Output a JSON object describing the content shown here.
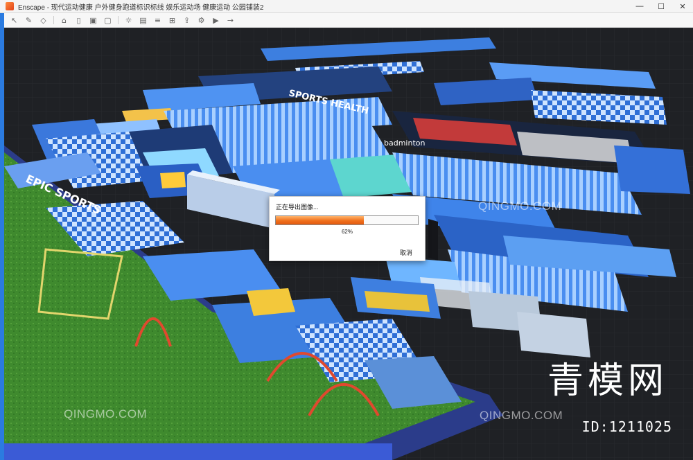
{
  "window": {
    "title": "Enscape - 现代运动健康 户外健身跑道标识标线 娱乐运动场 健康运动 公园铺装2",
    "controls": [
      "minimize",
      "maximize",
      "close"
    ]
  },
  "toolbar": {
    "icons": [
      "pointer-icon",
      "brush-icon",
      "tag-icon",
      "home-icon",
      "door-icon",
      "stamp-icon",
      "box-icon",
      "lamp-icon",
      "film-icon",
      "layers-icon",
      "ruler-icon",
      "export-icon",
      "gear-icon",
      "video-icon",
      "arrow-icon"
    ]
  },
  "scene": {
    "labels": {
      "banner_a": "SPORTS HEALTH",
      "banner_b": "EPIC SPORTS",
      "badminton": "badminton"
    }
  },
  "modal": {
    "title": "正在导出图像...",
    "progress": 0.62,
    "progress_text": "62%",
    "cancel_label": "取消"
  },
  "watermark": {
    "site": "QINGMO.COM",
    "brand": "青模网",
    "image_id": "ID:1211025"
  },
  "colors": {
    "accent": "#f0701c",
    "frame": "#2b7be0"
  }
}
